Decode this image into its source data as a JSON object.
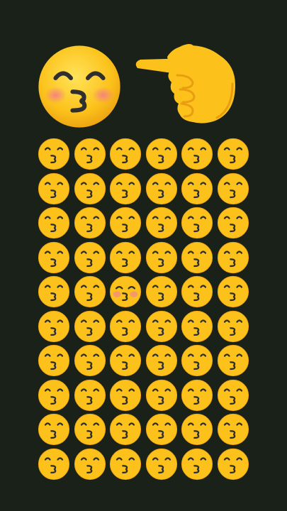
{
  "puzzle": {
    "target_emoji": "kissing-face-with-closed-eyes",
    "pointer_emoji": "backhand-index-pointing-right",
    "grid_emoji": "kissing-face-with-smiling-eyes",
    "rows": 10,
    "columns": 6,
    "odd_one_out": {
      "row": 5,
      "column": 3
    }
  },
  "colors": {
    "background": "#1a2119",
    "face_yellow": "#fcc21b",
    "face_shade": "#f19b16",
    "feature_dark": "#2f2f2f",
    "blush": "#f48a8a"
  }
}
